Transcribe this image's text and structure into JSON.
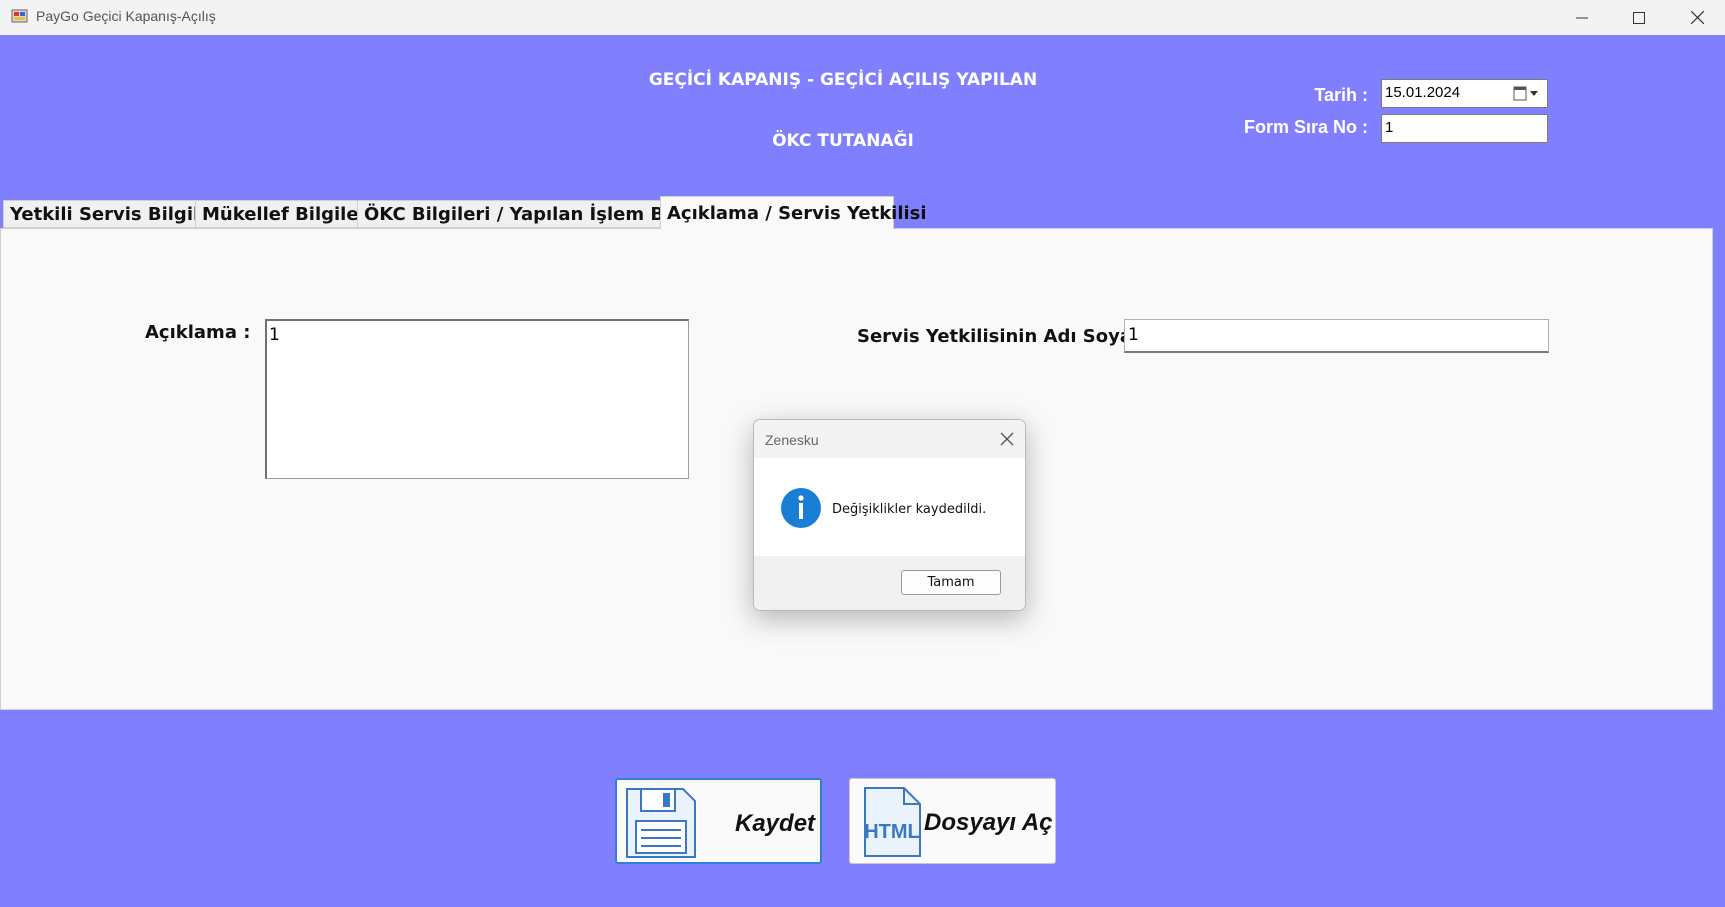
{
  "window": {
    "title": "PayGo Geçici Kapanış-Açılış"
  },
  "header": {
    "title_line1": "GEÇİCİ KAPANIŞ - GEÇİCİ AÇILIŞ YAPILAN",
    "title_line2": "ÖKC TUTANAĞI",
    "date_label": "Tarih :",
    "date_value": "15.01.2024",
    "form_no_label": "Form Sıra No :",
    "form_no_value": "1"
  },
  "tabs": [
    {
      "label": "Yetkili Servis Bilgileri"
    },
    {
      "label": "Mükellef Bilgileri"
    },
    {
      "label": "ÖKC Bilgileri / Yapılan İşlem Bilgisi"
    },
    {
      "label": "Açıklama / Servis Yetkilisi"
    }
  ],
  "panel": {
    "description_label": "Açıklama :",
    "description_value": "1",
    "service_name_label": "Servis Yetkilisinin Adı Soyadı:",
    "service_name_value": "1"
  },
  "buttons": {
    "save_label": "Kaydet",
    "open_file_label": "Dosyayı Aç",
    "html_icon_text": "HTML"
  },
  "dialog": {
    "title": "Zenesku",
    "message": "Değişiklikler kaydedildi.",
    "ok_label": "Tamam"
  },
  "colors": {
    "background": "#8080ff",
    "panel": "#f9f9f9",
    "info_icon": "#1a7fd4"
  }
}
